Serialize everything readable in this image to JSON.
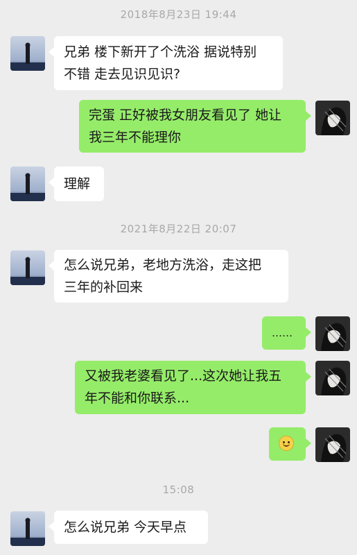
{
  "chat": {
    "timestamps": [
      "2018年8月23日 19:44",
      "2021年8月22日 20:07",
      "15:08"
    ],
    "messages": [
      {
        "from": "friend",
        "text": "兄弟 楼下新开了个洗浴 据说特别\n不错 走去见识见识?"
      },
      {
        "from": "me",
        "text": "完蛋 正好被我女朋友看见了 她让\n我三年不能理你"
      },
      {
        "from": "friend",
        "text": "理解"
      },
      {
        "from": "friend",
        "text": "怎么说兄弟，老地方洗浴，走这把\n三年的补回来"
      },
      {
        "from": "me",
        "text": "……"
      },
      {
        "from": "me",
        "text": "又被我老婆看见了...这次她让我五\n年不能和你联系..."
      },
      {
        "from": "me",
        "text": "",
        "emoji": "smile-emoji"
      },
      {
        "from": "friend",
        "text": "怎么说兄弟 今天早点"
      }
    ]
  },
  "colors": {
    "background": "#ededed",
    "incoming_bubble": "#ffffff",
    "outgoing_bubble": "#95ec69",
    "timestamp": "#a8a8a8"
  }
}
